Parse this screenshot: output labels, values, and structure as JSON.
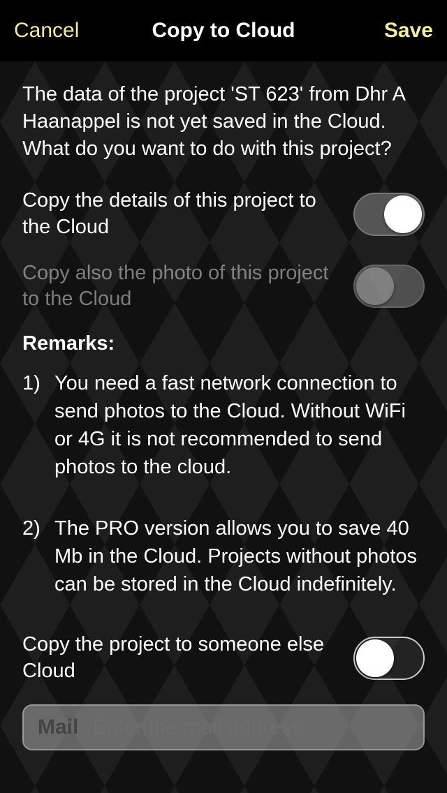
{
  "header": {
    "cancel": "Cancel",
    "title": "Copy to Cloud",
    "save": "Save"
  },
  "intro_text": "The data of the project 'ST 623' from Dhr A Haanappel is not yet saved in the Cloud. What do you want to do with this project?",
  "toggles": {
    "copy_details": {
      "label": "Copy the details of this project to the Cloud",
      "on": true
    },
    "copy_photo": {
      "label": "Copy also the photo of this project to the Cloud",
      "on": false,
      "disabled": true
    },
    "copy_someone_else": {
      "label": "Copy the project to someone else Cloud",
      "on": true
    }
  },
  "remarks": {
    "title": "Remarks:",
    "items": [
      {
        "num": "1)",
        "text": "You need a fast network connection to send photos to the Cloud. Without WiFi or 4G it is not recommended to send photos to the cloud."
      },
      {
        "num": "2)",
        "text": "The PRO version allows you to save 40 Mb in the Cloud. Projects without photos can be stored in the Cloud indefinitely."
      }
    ]
  },
  "mail": {
    "label": "Mail",
    "placeholder": "Enter the mail address",
    "value": ""
  }
}
